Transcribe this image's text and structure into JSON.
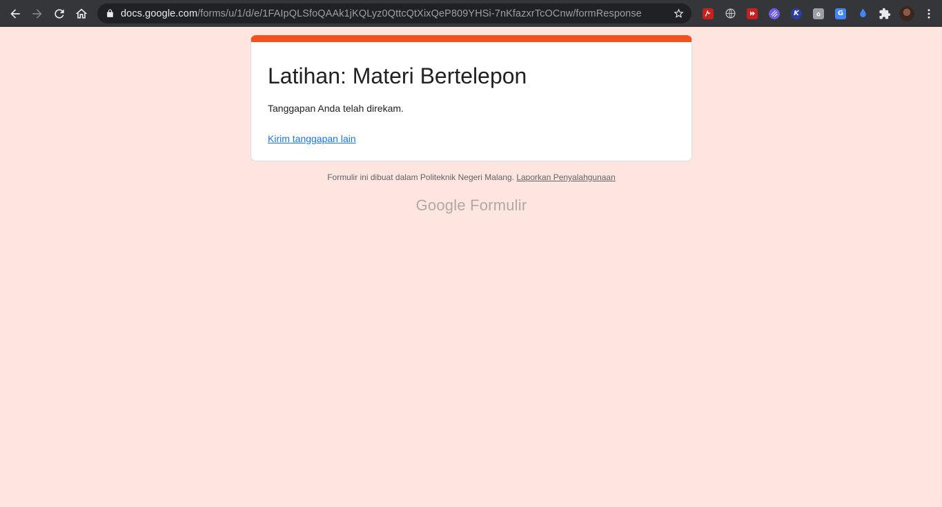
{
  "browser": {
    "url_domain": "docs.google.com",
    "url_path": "/forms/u/1/d/e/1FAIpQLSfoQAAk1jKQLyz0QttcQtXixQeP809YHSi-7nKfazxrTcOCnw/formResponse",
    "extensions": [
      {
        "name": "pdf-extension-icon",
        "glyph": "",
        "color": "#c5221f"
      },
      {
        "name": "globe-extension-icon",
        "glyph": "",
        "color": "#9aa0a6"
      },
      {
        "name": "video-extension-icon",
        "glyph": "",
        "color": "#c5221f"
      },
      {
        "name": "pattern-extension-icon",
        "glyph": "",
        "color": "#7b61ff"
      },
      {
        "name": "k-extension-icon",
        "glyph": "K",
        "color": "#3949ab"
      },
      {
        "name": "camera-extension-icon",
        "glyph": "",
        "color": "#9aa0a6"
      },
      {
        "name": "translate-extension-icon",
        "glyph": "G",
        "color": "#4285f4"
      },
      {
        "name": "drop-extension-icon",
        "glyph": "",
        "color": "#4285f4"
      }
    ]
  },
  "form": {
    "accent_color": "#f4511e",
    "title": "Latihan: Materi Bertelepon",
    "confirmation": "Tanggapan Anda telah direkam.",
    "submit_another": "Kirim tanggapan lain"
  },
  "footer": {
    "note": "Formulir ini dibuat dalam Politeknik Negeri Malang.",
    "report_link": "Laporkan Penyalahgunaan",
    "brand_google": "Google",
    "brand_product": "Formulir"
  }
}
